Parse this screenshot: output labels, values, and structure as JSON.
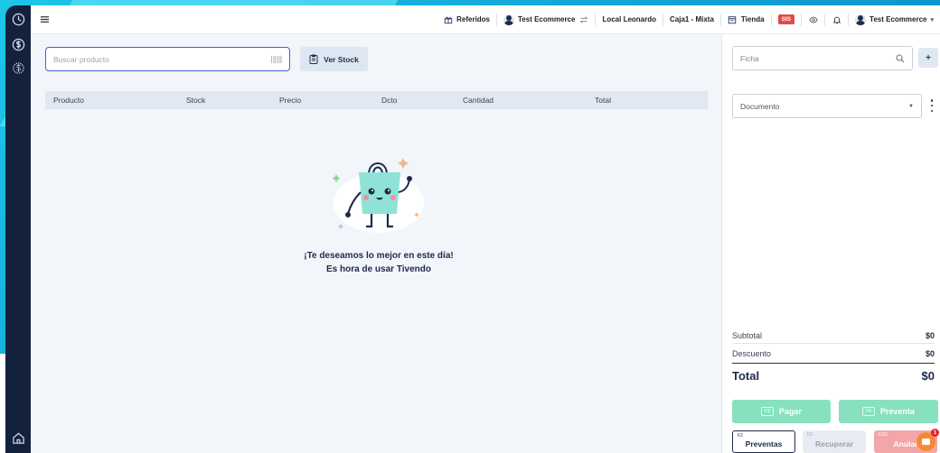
{
  "sidebar": {
    "icons": [
      "clock-icon",
      "dollar-circle-icon",
      "dollar-stacked-icon",
      "home-icon"
    ]
  },
  "topbar": {
    "referidos": "Referidos",
    "account_switch": "Test Ecommerce",
    "local": "Local Leonardo",
    "caja": "Caja1 - Mixta",
    "tienda": "Tienda",
    "badge": "SIS",
    "user": "Test Ecommerce"
  },
  "search": {
    "placeholder": "Buscar producto"
  },
  "stock_button": "Ver Stock",
  "table": {
    "columns": [
      "Producto",
      "Stock",
      "Precio",
      "Dcto",
      "Cantidad",
      "Total"
    ]
  },
  "empty_state": {
    "line1": "¡Te deseamos lo mejor en este día!",
    "line2": "Es hora de usar Tivendo"
  },
  "panel": {
    "ficha_placeholder": "Ficha",
    "plus_label": "+",
    "documento_label": "Documento",
    "subtotal_label": "Subtotal",
    "subtotal_value": "$0",
    "descuento_label": "Descuento",
    "descuento_value": "$0",
    "total_label": "Total",
    "total_value": "$0"
  },
  "actions": {
    "pagar_key": "F9",
    "pagar_label": "Pagar",
    "preventa_key": "F4",
    "preventa_label": "Preventa",
    "preventas_key": "F2",
    "preventas_label": "Preventas",
    "recuperar_key": "F3",
    "recuperar_label": "Recuperar",
    "anular_key": "ESC",
    "anular_label": "Anular",
    "chat_badge": "1"
  },
  "colors": {
    "primary": "#4b5bdb",
    "sidebar": "#14213d",
    "success": "#87e1be",
    "danger": "#f2a6a8",
    "badge_red": "#e4484a",
    "chat_orange": "#f58a35"
  }
}
